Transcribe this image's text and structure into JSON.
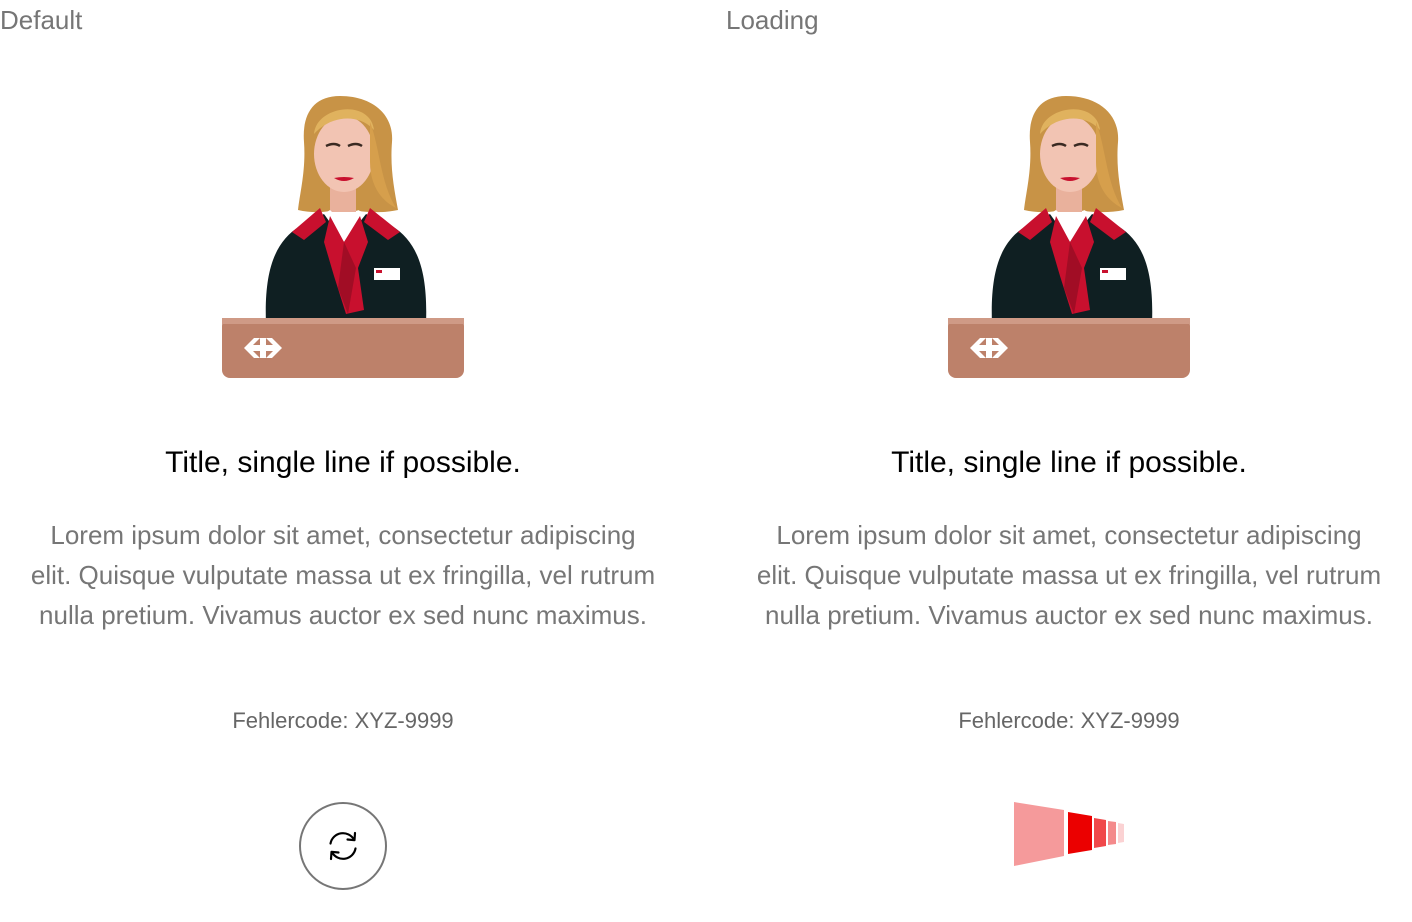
{
  "states": {
    "default": {
      "label": "Default",
      "title": "Title, single line if possible.",
      "body": "Lorem ipsum dolor sit amet, consectetur adipiscing elit. Quisque vulputate massa ut ex fringilla, vel rutrum nulla pretium. Vivamus auctor ex sed nunc maximus.",
      "error_code": "Fehlercode: XYZ-9999",
      "action_icon": "reload-icon"
    },
    "loading": {
      "label": "Loading",
      "title": "Title, single line if possible.",
      "body": "Lorem ipsum dolor sit amet, consectetur adipiscing elit. Quisque vulputate massa ut ex fringilla, vel rutrum nulla pretium. Vivamus auctor ex sed nunc maximus.",
      "error_code": "Fehlercode: XYZ-9999",
      "action_icon": "loading-indicator-icon"
    }
  },
  "colors": {
    "brand_red": "#eb0000",
    "text_grey": "#767676",
    "desk": "#bd816a",
    "jacket": "#0f1f22",
    "hair": "#d4a24e",
    "skin": "#f2c4b3"
  }
}
